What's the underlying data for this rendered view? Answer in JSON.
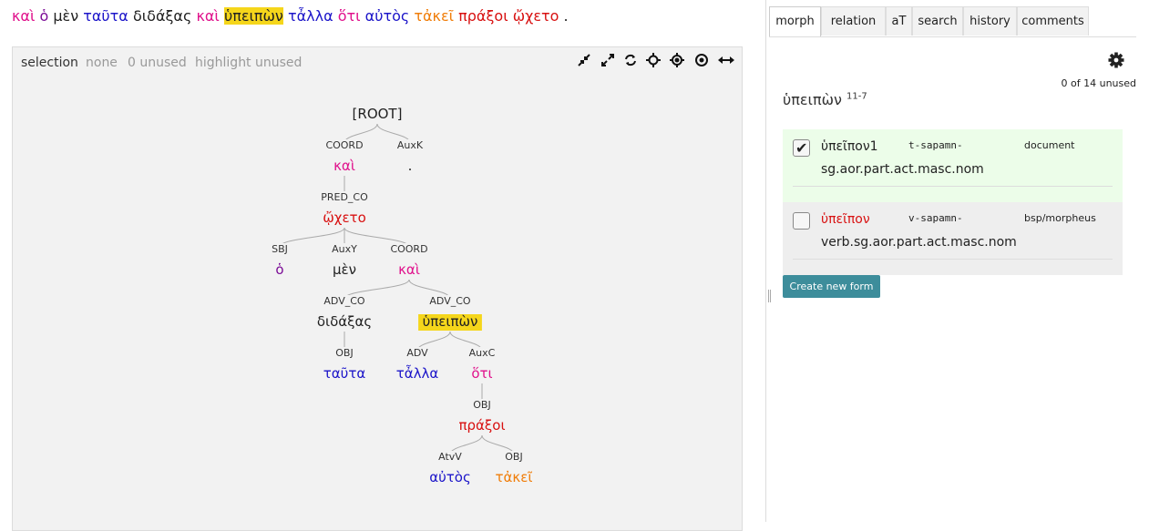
{
  "colors": {
    "pink": "#e0128c",
    "purple": "#7b0c96",
    "dark": "#222222",
    "blue": "#1c15c9",
    "red": "#d81111",
    "orange": "#f07d09",
    "highlight": "#f5d61b",
    "accept_bg": "#ecfde9",
    "alt_bg": "#eeeeee",
    "button": "#3d8d9b"
  },
  "sentence": [
    {
      "text": "καὶ",
      "color": "pink"
    },
    {
      "text": "ὁ",
      "color": "purple"
    },
    {
      "text": "μὲν",
      "color": "dark"
    },
    {
      "text": "ταῦτα",
      "color": "blue"
    },
    {
      "text": "διδάξας",
      "color": "dark"
    },
    {
      "text": "καὶ",
      "color": "pink"
    },
    {
      "text": "ὑπειπὼν",
      "color": "dark",
      "highlight": true
    },
    {
      "text": "τἆλλα",
      "color": "blue"
    },
    {
      "text": "ὅτι",
      "color": "pink"
    },
    {
      "text": "αὐτὸς",
      "color": "blue"
    },
    {
      "text": "τἀκεῖ",
      "color": "orange"
    },
    {
      "text": "πράξοι",
      "color": "red"
    },
    {
      "text": "ᾤχετο",
      "color": "red"
    },
    {
      "text": ".",
      "color": "dark"
    }
  ],
  "tree_toolbar": {
    "selection": "selection",
    "none": "none",
    "unused": "0 unused",
    "highlight_unused": "highlight unused",
    "buttons": [
      "compress-icon",
      "expand-icon",
      "refresh-icon",
      "move-icon",
      "crosshair-icon",
      "target-icon",
      "width-arrows-icon"
    ]
  },
  "tree": {
    "nodes": [
      {
        "id": "root",
        "text": "[ROOT]",
        "color": "dark",
        "label": ""
      },
      {
        "id": "kai1",
        "text": "καὶ",
        "color": "pink",
        "label": "COORD",
        "parent": "root"
      },
      {
        "id": "period",
        "text": ".",
        "color": "dark",
        "label": "AuxK",
        "parent": "root"
      },
      {
        "id": "wxeto",
        "text": "ᾤχετο",
        "color": "red",
        "label": "PRED_CO",
        "parent": "kai1"
      },
      {
        "id": "ho",
        "text": "ὁ",
        "color": "purple",
        "label": "SBJ",
        "parent": "wxeto"
      },
      {
        "id": "men",
        "text": "μὲν",
        "color": "dark",
        "label": "AuxY",
        "parent": "wxeto"
      },
      {
        "id": "kai2",
        "text": "καὶ",
        "color": "pink",
        "label": "COORD",
        "parent": "wxeto"
      },
      {
        "id": "didaxas",
        "text": "διδάξας",
        "color": "dark",
        "label": "ADV_CO",
        "parent": "kai2"
      },
      {
        "id": "hypeipon",
        "text": "ὑπειπὼν",
        "color": "dark",
        "label": "ADV_CO",
        "parent": "kai2",
        "highlight": true
      },
      {
        "id": "tauta",
        "text": "ταῦτα",
        "color": "blue",
        "label": "OBJ",
        "parent": "didaxas"
      },
      {
        "id": "talla",
        "text": "τἆλλα",
        "color": "blue",
        "label": "ADV",
        "parent": "hypeipon"
      },
      {
        "id": "hoti",
        "text": "ὅτι",
        "color": "pink",
        "label": "AuxC",
        "parent": "hypeipon"
      },
      {
        "id": "praxoi",
        "text": "πράξοι",
        "color": "red",
        "label": "OBJ",
        "parent": "hoti"
      },
      {
        "id": "autos",
        "text": "αὐτὸς",
        "color": "blue",
        "label": "AtvV",
        "parent": "praxoi"
      },
      {
        "id": "takei",
        "text": "τἀκεῖ",
        "color": "orange",
        "label": "OBJ",
        "parent": "praxoi"
      }
    ]
  },
  "tabs": [
    {
      "label": "morph",
      "active": true
    },
    {
      "label": "relation",
      "active": false
    },
    {
      "label": "aT",
      "active": false
    },
    {
      "label": "search",
      "active": false
    },
    {
      "label": "history",
      "active": false
    },
    {
      "label": "comments",
      "active": false
    }
  ],
  "morph": {
    "settings_icon": "gear-icon",
    "unused_count": "0 of 14 unused",
    "title": "ὑπειπὼν",
    "title_id": "11-7",
    "forms": [
      {
        "lemma": "ὑπεῖπον1",
        "lemma_color": "dark",
        "code": "t-sapamn-",
        "source": "document",
        "morph": "sg.aor.part.act.masc.nom",
        "checked": true,
        "bg": "accept_bg"
      },
      {
        "lemma": "ὑπεῖπον",
        "lemma_color": "red",
        "code": "v-sapamn-",
        "source": "bsp/morpheus",
        "morph": "verb.sg.aor.part.act.masc.nom",
        "checked": false,
        "bg": "alt_bg"
      }
    ],
    "create_button": "Create new form"
  }
}
